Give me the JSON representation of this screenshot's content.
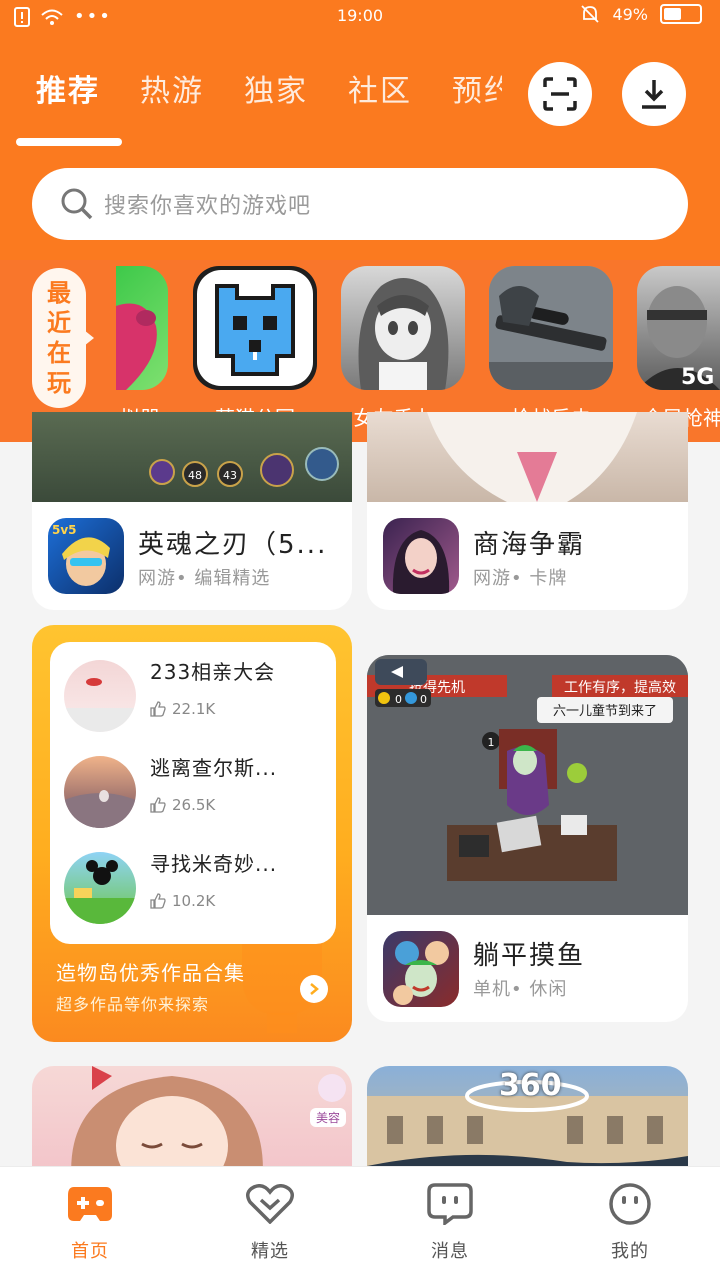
{
  "status": {
    "time": "19:00",
    "battery": "49%",
    "battery_level": 0.49
  },
  "tabs": [
    {
      "label": "推荐",
      "active": true
    },
    {
      "label": "热游"
    },
    {
      "label": "独家"
    },
    {
      "label": "社区"
    },
    {
      "label": "预约"
    }
  ],
  "search": {
    "placeholder": "搜索你喜欢的游戏吧"
  },
  "recent": {
    "label_chars": [
      "最",
      "近",
      "在",
      "玩"
    ],
    "games": [
      {
        "name": "拟器"
      },
      {
        "name": "萌猫公园"
      },
      {
        "name": "女友手办..."
      },
      {
        "name": "枪战反击"
      },
      {
        "name": "全民枪神"
      }
    ]
  },
  "feed": {
    "card1": {
      "title": "英魂之刃（5...",
      "tags": "网游• 编辑精选",
      "hud_numbers": [
        "48",
        "43"
      ]
    },
    "card2": {
      "title": "商海争霸",
      "tags": "网游• 卡牌"
    },
    "collection": {
      "items": [
        {
          "name": "233相亲大会",
          "likes": "22.1K"
        },
        {
          "name": "逃离查尔斯...",
          "likes": "26.5K"
        },
        {
          "name": "寻找米奇妙...",
          "likes": "10.2K"
        }
      ],
      "title": "造物岛优秀作品合集",
      "subtitle": "超多作品等你来探索"
    },
    "card3": {
      "title": "躺平摸鱼",
      "tags": "单机• 休闲",
      "banner_left": "抢得先机",
      "banner_right": "工作有序，提高效",
      "bubble": "六一儿童节到来了",
      "counter_a": "0",
      "counter_b": "0",
      "badge": "1"
    },
    "card4": {
      "tag": "美容"
    },
    "card5": {
      "badge": "360"
    }
  },
  "bottom_nav": [
    {
      "label": "首页",
      "active": true
    },
    {
      "label": "精选"
    },
    {
      "label": "消息"
    },
    {
      "label": "我的"
    }
  ],
  "colors": {
    "accent": "#fb7a1f",
    "collection": "#ffad1f"
  }
}
